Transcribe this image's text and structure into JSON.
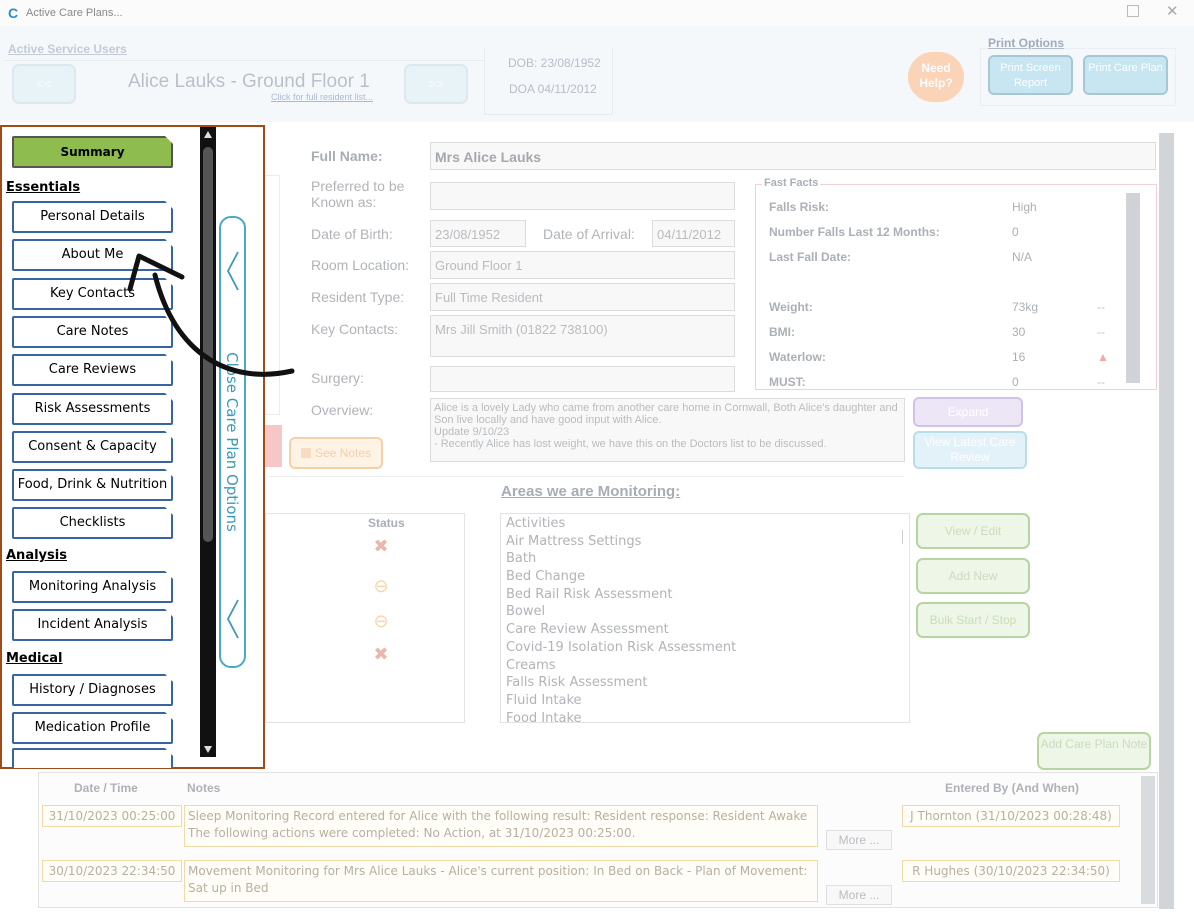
{
  "window": {
    "title": "Active Care Plans..."
  },
  "header": {
    "active_users_label": "Active Service Users",
    "prev_label": "<<",
    "next_label": ">>",
    "resident_name": "Alice Lauks - Ground Floor 1",
    "full_list_link": "Click for full resident list...",
    "dob": "DOB: 23/08/1952",
    "doa": "DOA 04/11/2012",
    "help": "Need Help?",
    "print_options_label": "Print Options",
    "print_screen": "Print Screen Report",
    "print_care_plan": "Print Care Plan"
  },
  "form": {
    "full_name_label": "Full Name:",
    "full_name": "Mrs Alice Lauks",
    "preferred_label": "Preferred to be Known as:",
    "preferred": "",
    "dob_label": "Date of Birth:",
    "dob": "23/08/1952",
    "arrival_label": "Date of Arrival:",
    "arrival": "04/11/2012",
    "room_label": "Room Location:",
    "room": "Ground Floor 1",
    "type_label": "Resident Type:",
    "type": "Full Time Resident",
    "contacts_label": "Key Contacts:",
    "contacts": "Mrs Jill Smith (01822 738100)",
    "surgery_label": "Surgery:",
    "surgery": "",
    "overview_label": "Overview:",
    "overview": "Alice is a lovely Lady who came from another care home in Cornwall, Both Alice's daughter and Son live locally and have good input with Alice.\nUpdate 9/10/23\n- Recently Alice has lost weight, we have this on the Doctors list to be discussed.",
    "see_notes": "See Notes",
    "expand": "Expand",
    "view_latest": "View Latest Care Review"
  },
  "fast_facts": {
    "title": "Fast Facts",
    "rows": [
      {
        "label": "Falls Risk:",
        "value": "High",
        "trend": ""
      },
      {
        "label": "Number Falls Last 12 Months:",
        "value": "0",
        "trend": ""
      },
      {
        "label": "Last Fall Date:",
        "value": "N/A",
        "trend": ""
      },
      {
        "label": "Weight:",
        "value": "73kg",
        "trend": "--"
      },
      {
        "label": "BMI:",
        "value": "30",
        "trend": "--"
      },
      {
        "label": "Waterlow:",
        "value": "16",
        "trend": "▲"
      },
      {
        "label": "MUST:",
        "value": "0",
        "trend": "--"
      }
    ]
  },
  "monitoring": {
    "title": "Areas we are Monitoring:",
    "status_header": "Status",
    "items": [
      "Activities",
      "Air Mattress Settings",
      "Bath",
      "Bed Change",
      "Bed Rail Risk Assessment",
      "Bowel",
      "Care Review Assessment",
      "Covid-19 Isolation Risk Assessment",
      "Creams",
      "Falls Risk Assessment",
      "Fluid Intake",
      "Food Intake"
    ],
    "view_edit": "View / Edit",
    "add_new": "Add New",
    "bulk": "Bulk Start / Stop",
    "add_care_plan_note": "Add Care Plan Note"
  },
  "notes": {
    "headers": {
      "date": "Date / Time",
      "notes": "Notes",
      "entered": "Entered By (And When)"
    },
    "more_label": "More ...",
    "rows": [
      {
        "date": "31/10/2023 00:25:00",
        "text": "Sleep Monitoring Record entered for Alice with the following result: Resident response: Resident Awake\nThe following actions were completed:  No Action, at 31/10/2023 00:25:00.",
        "by": "J Thornton (31/10/2023 00:28:48)"
      },
      {
        "date": "30/10/2023 22:34:50",
        "text": "Movement Monitoring for Mrs Alice Lauks - Alice's current position: In Bed on Back - Plan of Movement: Sat up in Bed",
        "by": "R Hughes (30/10/2023 22:34:50)"
      }
    ]
  },
  "sidebar": {
    "summary": "Summary",
    "essentials_heading": "Essentials",
    "essentials": [
      "Personal Details",
      "About Me",
      "Key Contacts",
      "Care Notes",
      "Care Reviews",
      "Risk Assessments",
      "Consent & Capacity",
      "Food, Drink & Nutrition",
      "Checklists"
    ],
    "analysis_heading": "Analysis",
    "analysis": [
      "Monitoring Analysis",
      "Incident Analysis"
    ],
    "medical_heading": "Medical",
    "medical": [
      "History / Diagnoses",
      "Medication Profile"
    ],
    "close_panel": "Close Care Plan Options"
  },
  "colors": {
    "sidebar_border": "#a14b18",
    "button_border": "#3764a2",
    "summary_green": "#8fbc4f",
    "panel_teal": "#48a9c5"
  }
}
